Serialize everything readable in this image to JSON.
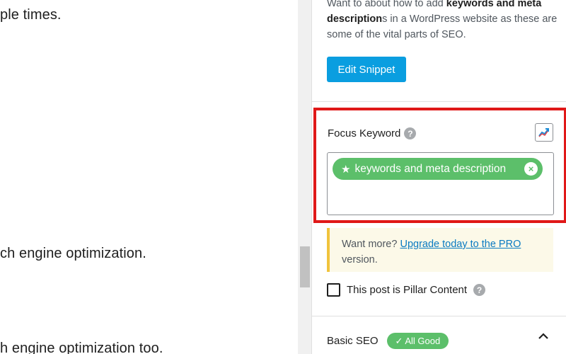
{
  "editor": {
    "line1": "ple times.",
    "line2": "ch engine optimization.",
    "line3": "h engine optimization too."
  },
  "sidebar": {
    "intro_part1": "Want to about how to add ",
    "intro_bold1": "keywords and meta description",
    "intro_part2": "s in a WordPress website as these are some of the vital parts of SEO.",
    "edit_snippet_label": "Edit Snippet",
    "focus_keyword": {
      "label": "Focus Keyword",
      "help_icon": "?",
      "trend_icon": "trend-chart-icon",
      "keyword": "keywords and meta description",
      "remove_icon": "×"
    },
    "upgrade_notice": {
      "prefix": "Want more? ",
      "link": "Upgrade today to the PRO",
      "suffix": "version."
    },
    "pillar_label": "This post is Pillar Content",
    "pillar_checked": false,
    "basic_seo": {
      "title": "Basic SEO",
      "badge": "✓ All Good",
      "chevron_icon": "chevron-up-icon"
    }
  },
  "colors": {
    "accent_blue": "#0a9ee0",
    "tag_green": "#5cbf6a",
    "highlight_red": "#e01818",
    "notice_border": "#f0c33c"
  }
}
